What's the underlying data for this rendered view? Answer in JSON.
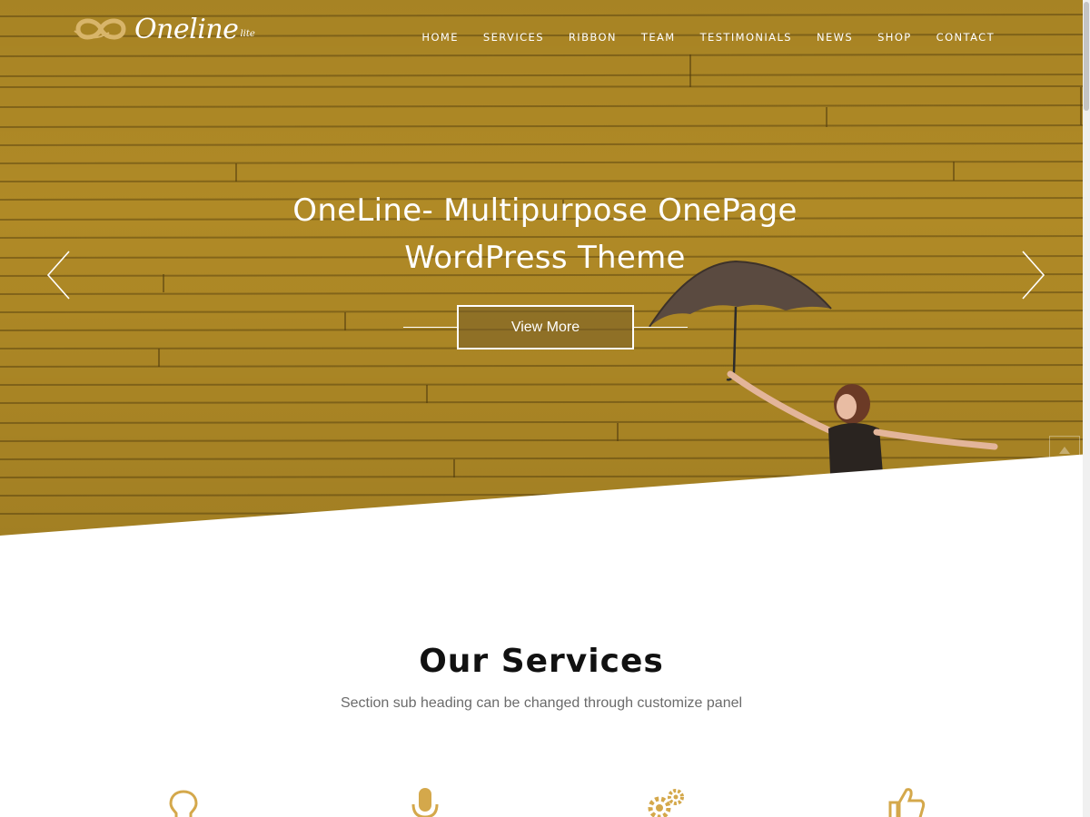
{
  "brand": {
    "name": "Oneline",
    "sub": "lite",
    "accent": "#c9a14a",
    "hero_color": "#b08a26"
  },
  "nav": {
    "items": [
      "HOME",
      "SERVICES",
      "RIBBON",
      "TEAM",
      "TESTIMONIALS",
      "NEWS",
      "SHOP",
      "CONTACT"
    ]
  },
  "hero": {
    "title_line1": "OneLine- Multipurpose OnePage",
    "title_line2": "WordPress Theme",
    "cta_label": "View More",
    "prev_icon": "chevron-left-icon",
    "next_icon": "chevron-right-icon"
  },
  "services": {
    "title": "Our Services",
    "subtitle": "Section sub heading can be changed through customize panel",
    "icons": [
      "lightbulb-icon",
      "microphone-icon",
      "gears-icon",
      "thumbs-up-icon"
    ]
  }
}
